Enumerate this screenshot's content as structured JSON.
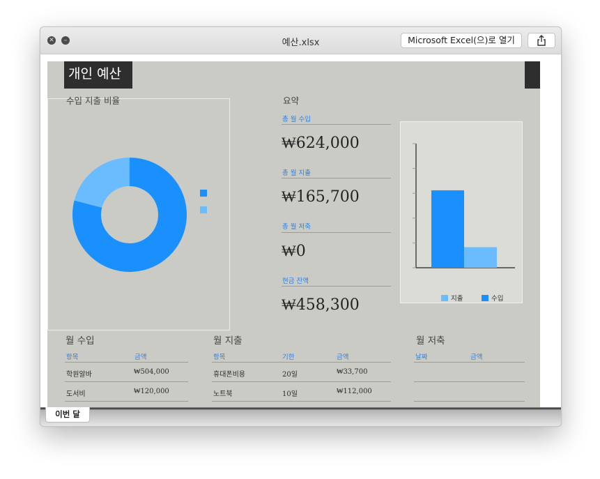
{
  "window": {
    "title": "예산.xlsx",
    "open_with_label": "Microsoft Excel(으)로 열기"
  },
  "sheet": {
    "title": "개인 예산",
    "pie_section_label": "수입 지출 비율",
    "summary_label": "요약",
    "summary": [
      {
        "label": "총 월 수입",
        "value": "₩624,000"
      },
      {
        "label": "총 월 지출",
        "value": "₩165,700"
      },
      {
        "label": "총 월 저축",
        "value": "₩0"
      },
      {
        "label": "현금 잔액",
        "value": "₩458,300"
      }
    ],
    "income": {
      "title": "월 수입",
      "headers": [
        "항목",
        "금액"
      ],
      "rows": [
        {
          "item": "학원알바",
          "amount": "₩504,000"
        },
        {
          "item": "도서비",
          "amount": "₩120,000"
        }
      ]
    },
    "expense": {
      "title": "월 지출",
      "headers": [
        "항목",
        "기한",
        "금액"
      ],
      "rows": [
        {
          "item": "휴대폰비용",
          "due": "20일",
          "amount": "₩33,700"
        },
        {
          "item": "노트북",
          "due": "10일",
          "amount": "₩112,000"
        }
      ]
    },
    "savings": {
      "title": "월 저축",
      "headers": [
        "날짜",
        "금액"
      ],
      "rows": []
    }
  },
  "tabs": [
    {
      "label": "이번 달",
      "active": true
    }
  ],
  "colors": {
    "income": "#1a90ff",
    "expense": "#6bbcff",
    "sheet_bg": "#cbcbc6",
    "header_text": "#2a80e6"
  },
  "icons": {
    "close": "close-icon",
    "minimize": "minimize-icon",
    "share": "share-icon"
  },
  "chart_data": [
    {
      "type": "pie",
      "donut": true,
      "labels": [
        "수입",
        "지출"
      ],
      "values": [
        624000,
        165700
      ],
      "colors": [
        "#1a90ff",
        "#6bbcff"
      ]
    },
    {
      "type": "bar",
      "categories": [
        "수입",
        "지출"
      ],
      "values": [
        624000,
        165700
      ],
      "colors": [
        "#1a90ff",
        "#6bbcff"
      ],
      "legend": [
        {
          "name": "지출",
          "color": "#6bbcff"
        },
        {
          "name": "수입",
          "color": "#1a90ff"
        }
      ],
      "legend_position": "bottom",
      "ylim": [
        0,
        1000000
      ],
      "grid": false
    }
  ]
}
